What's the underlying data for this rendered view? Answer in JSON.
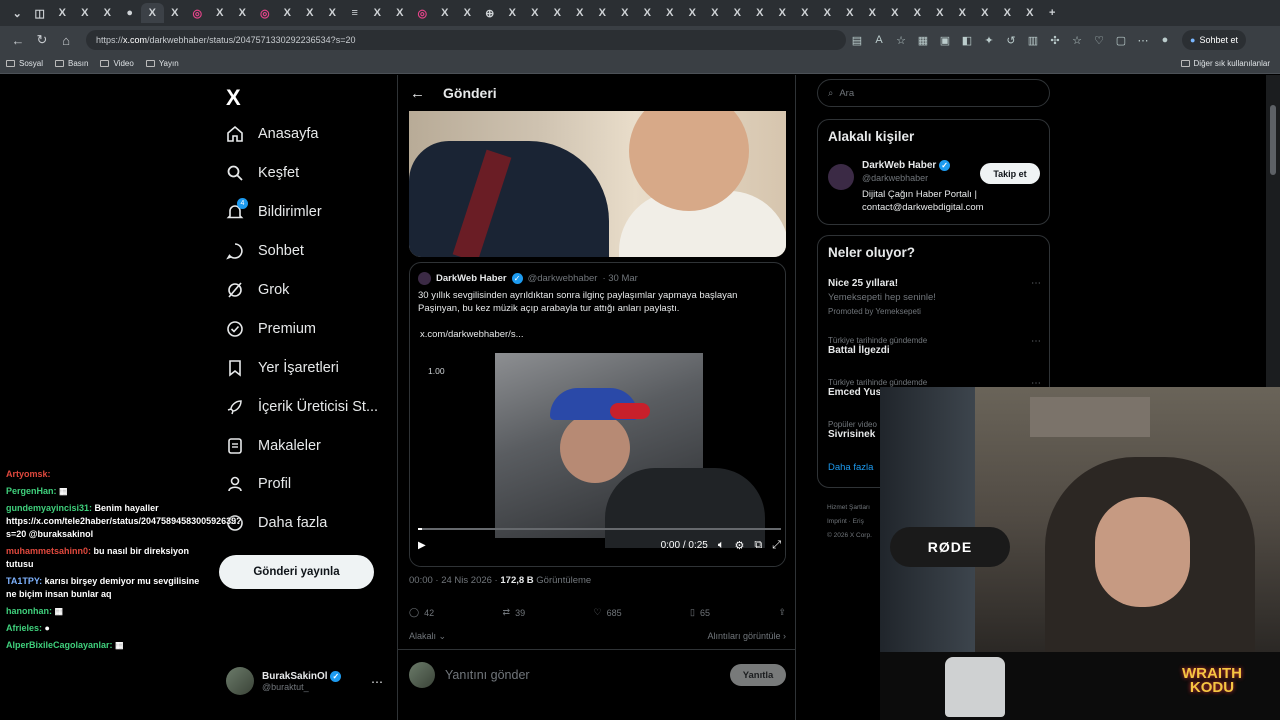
{
  "browser": {
    "url_prefix": "https://",
    "url_host": "x.com",
    "url_path": "/darkwebhaber/status/2047571330292236534?s=20",
    "chat_button": "Sohbet et",
    "bookmarks": [
      "Sosyal",
      "Basın",
      "Video",
      "Yayın"
    ],
    "other_bookmarks": "Diğer sık kullanılanlar"
  },
  "nav": {
    "logo": "X",
    "items": [
      {
        "label": "Anasayfa",
        "icon": "home-icon"
      },
      {
        "label": "Keşfet",
        "icon": "search-icon"
      },
      {
        "label": "Bildirimler",
        "icon": "bell-icon",
        "badge": "4"
      },
      {
        "label": "Sohbet",
        "icon": "chat-icon"
      },
      {
        "label": "Grok",
        "icon": "grok-icon"
      },
      {
        "label": "Premium",
        "icon": "premium-icon"
      },
      {
        "label": "Yer İşaretleri",
        "icon": "bookmark-icon"
      },
      {
        "label": "İçerik Üreticisi St...",
        "icon": "rocket-icon"
      },
      {
        "label": "Makaleler",
        "icon": "article-icon"
      },
      {
        "label": "Profil",
        "icon": "person-icon"
      },
      {
        "label": "Daha fazla",
        "icon": "more-icon"
      }
    ],
    "post_button": "Gönderi yayınla",
    "account": {
      "name": "BurakSakinOl",
      "handle": "@buraktut_"
    }
  },
  "post": {
    "header_title": "Gönderi",
    "quote": {
      "name": "DarkWeb Haber",
      "handle": "@darkwebhaber",
      "date": "· 30 Mar",
      "text": "30 yıllık sevgilisinden ayrıldıktan sonra ilginç paylaşımlar yapmaya başlayan Paşinyan, bu kez müzik açıp arabayla tur attığı anları paylaştı.",
      "link": "x.com/darkwebhaber/s...",
      "video": {
        "speed": "1.00",
        "time": "0:00 / 0:25",
        "progress": 0.01
      }
    },
    "meta_time": "00:00 · 24 Nis 2026 ·",
    "meta_views": "172,8 B",
    "meta_views_label": "Görüntüleme",
    "actions": {
      "replies": "42",
      "reposts": "39",
      "likes": "685",
      "bookmarks": "65"
    },
    "related_label": "Alakalı",
    "quotes_label": "Alıntıları görüntüle",
    "reply_placeholder": "Yanıtını gönder",
    "reply_button": "Yanıtla"
  },
  "sidebar": {
    "search_placeholder": "Ara",
    "related_title": "Alakalı kişiler",
    "person": {
      "name": "DarkWeb Haber",
      "handle": "@darkwebhaber",
      "bio": "Dijital Çağın Haber Portalı | contact@darkwebdigital.com",
      "follow": "Takip et"
    },
    "trends_title": "Neler oluyor?",
    "trends": [
      {
        "kind": "",
        "title": "Nice 25 yıllara!",
        "sub": "Yemeksepeti hep seninle!",
        "promo": "Promoted by Yemeksepeti"
      },
      {
        "kind": "Türkiye tarihinde gündemde",
        "title": "Battal İlgezdi",
        "sub": "",
        "promo": ""
      },
      {
        "kind": "Türkiye tarihinde gündemde",
        "title": "Emced Yus",
        "sub": "",
        "promo": ""
      },
      {
        "kind": "Popüler video",
        "title": "Sivrisinek",
        "sub": "",
        "promo": ""
      }
    ],
    "more": "Daha fazla",
    "footer": [
      "Hizmet Şartları",
      "Imprint · Eriş",
      "© 2026 X Corp."
    ]
  },
  "chat": [
    {
      "user": "Artyomsk:",
      "text": "",
      "color": "#e0483d"
    },
    {
      "user": "PergenHan:",
      "text": "▦",
      "color": "#3fd07c"
    },
    {
      "user": "gundemyayincisi31:",
      "text": "Benim hayaller https://x.com/tele2haber/status/2047589458300592639?s=20 @buraksakinol",
      "color": "#3fd07c"
    },
    {
      "user": "muhammetsahinn0:",
      "text": "bu nasıl bir direksiyon tutusu",
      "color": "#e0483d"
    },
    {
      "user": "TA1TPY:",
      "text": "karısı birşey demiyor mu sevgilisine ne biçim insan bunlar aq",
      "color": "#7fb3ff"
    },
    {
      "user": "hanonhan:",
      "text": "▦",
      "color": "#3fd07c"
    },
    {
      "user": "Afrieles:",
      "text": "●",
      "color": "#3fd07c"
    },
    {
      "user": "AlperBixileCagolayanlar:",
      "text": "▦",
      "color": "#3fd07c"
    }
  ],
  "overlay": {
    "mic_brand": "RØDE",
    "stream_brand_1": "WRAITH",
    "stream_brand_2": "KODU"
  }
}
